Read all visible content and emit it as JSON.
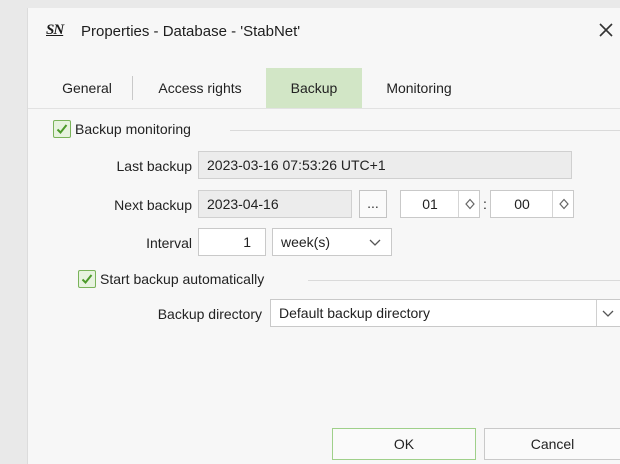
{
  "window": {
    "logo_text": "SN",
    "title": "Properties - Database - 'StabNet'",
    "close_symbol": "✕"
  },
  "tabs": [
    {
      "label": "General",
      "active": false
    },
    {
      "label": "Access rights",
      "active": false
    },
    {
      "label": "Backup",
      "active": true
    },
    {
      "label": "Monitoring",
      "active": false
    }
  ],
  "backup": {
    "monitoring_label": "Backup monitoring",
    "monitoring_checked": true,
    "last_backup_label": "Last backup",
    "last_backup_value": "2023-03-16 07:53:26 UTC+1",
    "next_backup_label": "Next backup",
    "next_backup_date": "2023-04-16",
    "browse_label": "...",
    "next_backup_hour": "01",
    "time_separator": ":",
    "next_backup_minute": "00",
    "interval_label": "Interval",
    "interval_value": "1",
    "interval_unit": "week(s)",
    "start_auto_label": "Start backup automatically",
    "start_auto_checked": true,
    "directory_label": "Backup directory",
    "directory_value": "Default backup directory"
  },
  "buttons": {
    "ok": "OK",
    "cancel": "Cancel"
  },
  "colors": {
    "accent_green": "#7ab35a",
    "active_tab_bg": "#d2e6c6"
  }
}
